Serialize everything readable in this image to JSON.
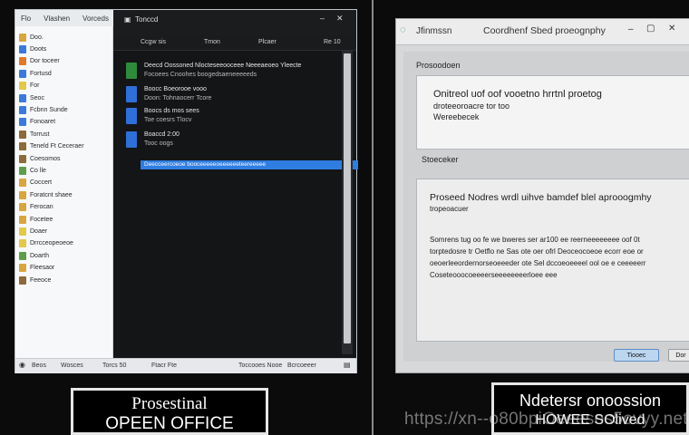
{
  "explorer": {
    "title_tokens": [
      "Flo",
      "Vlashen",
      "Vorceds"
    ],
    "content_title": "Tonccd",
    "column_header": [
      "Ccgw sis",
      "Tmon",
      "Plcaer",
      "Re 10"
    ],
    "nav_items": [
      {
        "label": "Doo.",
        "color": "#d8a640"
      },
      {
        "label": "Doots",
        "color": "#3b7ad9"
      },
      {
        "label": "Dor toceer",
        "color": "#e07a2a"
      },
      {
        "label": "Fortusd",
        "color": "#3b7ad9"
      },
      {
        "label": "For",
        "color": "#e3c84a"
      },
      {
        "label": "Seoc",
        "color": "#3b7ad9"
      },
      {
        "label": "Fcbnn Sunde",
        "color": "#3b7ad9"
      },
      {
        "label": "Fonoaret",
        "color": "#3b7ad9"
      },
      {
        "label": "Torrust",
        "color": "#8c6a3a"
      },
      {
        "label": "Teneld Ft Ceceraer",
        "color": "#8c6a3a"
      },
      {
        "label": "Coesomos",
        "color": "#8c6a3a"
      },
      {
        "label": "Co lle",
        "color": "#5e9e4a"
      },
      {
        "label": "Coccert",
        "color": "#d8a640"
      },
      {
        "label": "Foratcnt shaee",
        "color": "#d8a640"
      },
      {
        "label": "Ferocan",
        "color": "#d8a640"
      },
      {
        "label": "Focetee",
        "color": "#d8a640"
      },
      {
        "label": "Doaer",
        "color": "#e3c84a"
      },
      {
        "label": "Drrcceopeoeoe",
        "color": "#e3c84a"
      },
      {
        "label": "Doarth",
        "color": "#5e9e4a"
      },
      {
        "label": "Fleesaor",
        "color": "#d8a640"
      },
      {
        "label": "Feeoce",
        "color": "#8c6a3a"
      }
    ],
    "rows": [
      {
        "line1": "Deecd Oossoned Nlocteseeooceee Neeeaeoeo Yleecte",
        "line2": "Focoees Cnoohes boogedsaeneeeeeds",
        "color": "#2e8b3c"
      },
      {
        "line1": "Boocc Boeorooe vooo",
        "line2": "Doon: Tohnaocerr Tcore",
        "color": "#2f6fd8"
      },
      {
        "line1": "Boocs ds mos sees",
        "line2": "Toe coesrs Tlocv",
        "color": "#2f6fd8"
      },
      {
        "line1": "Boaccd 2:00",
        "line2": "Tooc oogs",
        "color": "#2f6fd8"
      }
    ],
    "selected_row": "Deecceercoeoe booceeeeeoeeeeeeteereeeee",
    "status": [
      "Beos",
      "Wosces",
      "Torcs 50",
      "Ftacr Fte",
      "Toccooes Nooe",
      "Bcrcoeeer"
    ]
  },
  "dialog": {
    "title": "Jfinmssn",
    "title_right": "Coordhenf Sbed proeognphy",
    "section1_label": "Prosoodoen",
    "panel1_lines": [
      "Onitreol uof oof vooetno hrrtnl proetog",
      "droteeoroacre tor too",
      "Wereebecek"
    ],
    "section2_label": "Stoeceker",
    "panel2_heading": "Proseed Nodres wrdl uihve bamdef blel aprooogmhy",
    "panel2_subheading": "tropeoacuer",
    "panel2_lines": [
      "Somrens tug oo fe we bweres ser ar100 ee reerneeeeeeee oof 0t",
      "torptedosre tr Oetflo ne Sas ote oer ofrl Deoceocoeoe ecorr eoe or",
      "oeoerleeordernorseoeeeder ote Sel dccoeoeeeel ool oe e ceeeeerr",
      "Coseteooocoeeeerseeeeeeeerloee eee"
    ],
    "ok_label": "Tiooec",
    "cancel_label": "Dor"
  },
  "captions": {
    "left_line1": "Prosestinal",
    "left_line2": "OPEEN OFFICE",
    "right_line1": "Ndetersr onoossion",
    "right_line2": "HOWEE SOlived"
  },
  "watermark": "https://xn--o80bpiOeeesos5ovyy.net"
}
